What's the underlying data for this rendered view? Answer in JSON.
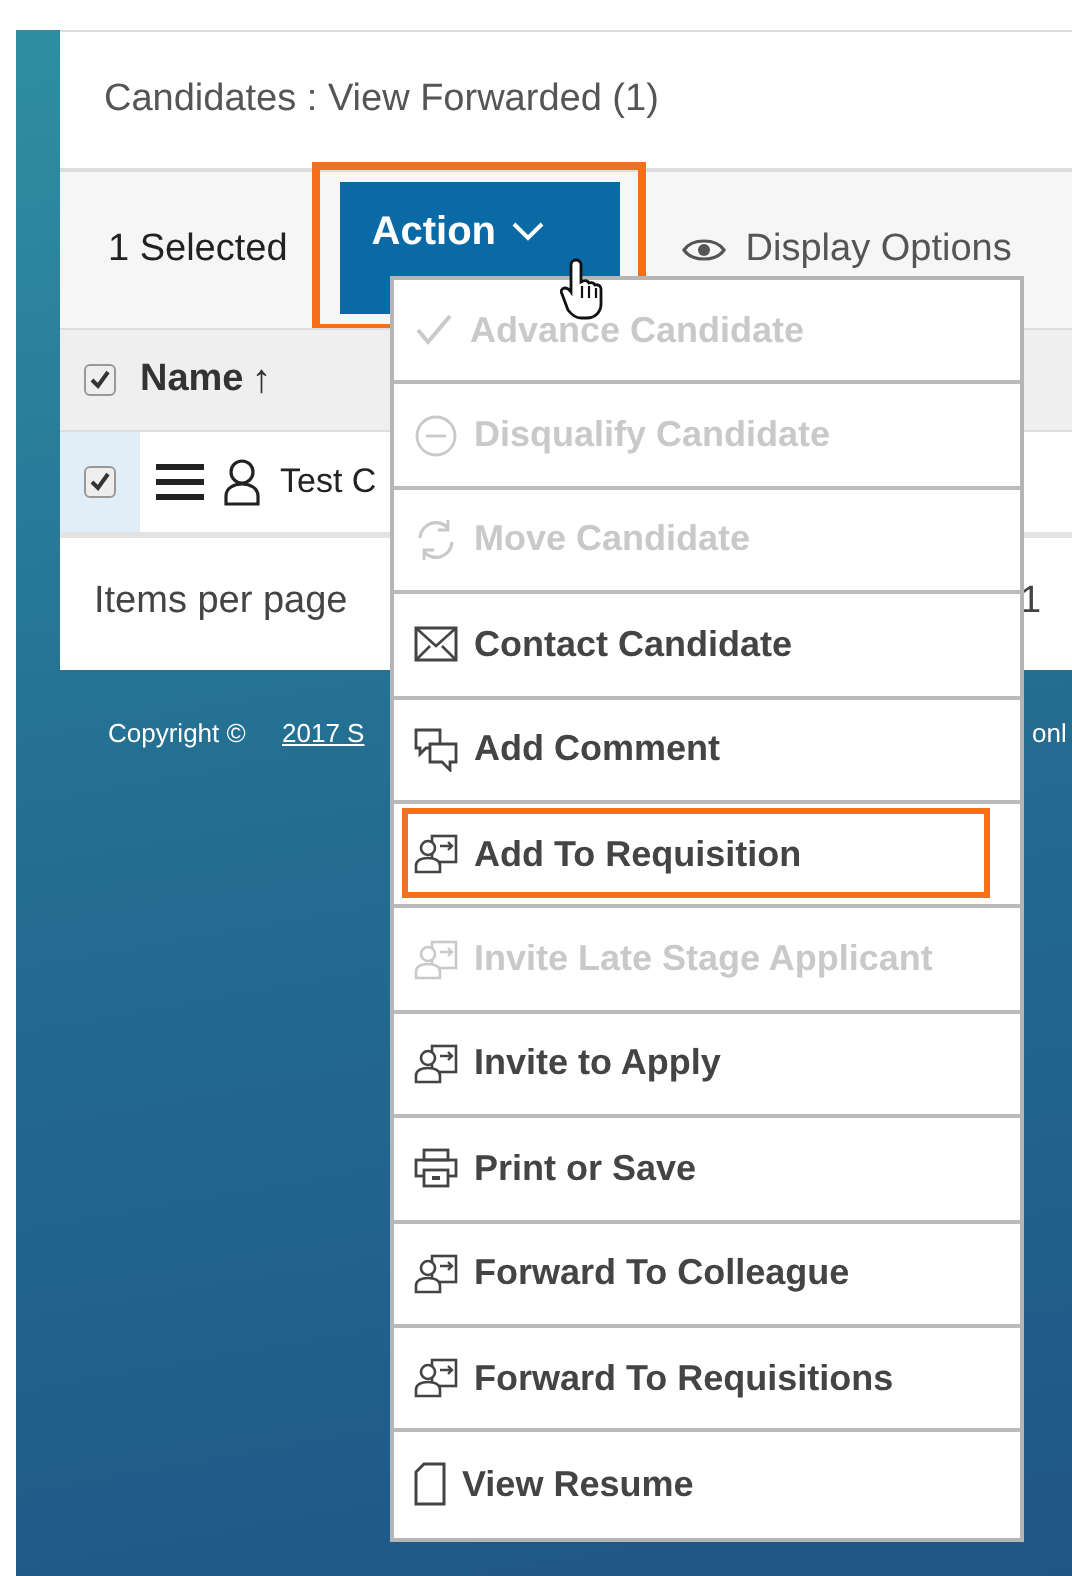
{
  "panel": {
    "title": "Candidates : View Forwarded (1)"
  },
  "toolbar": {
    "selected_count": "1 Selected",
    "action_button": {
      "label": "Action",
      "highlighted": true
    },
    "display_options": "Display Options"
  },
  "table": {
    "header": {
      "checked": true,
      "name_column": "Name",
      "sort_arrow": "↑"
    },
    "rows": [
      {
        "checked": true,
        "name": "Test C"
      }
    ]
  },
  "pagination": {
    "items_per_page": "Items per page",
    "page": "1"
  },
  "footer": {
    "copyright": "Copyright ©",
    "link": "2017 S",
    "trailing": "onl"
  },
  "menu": {
    "items": [
      {
        "label": "Advance Candidate",
        "kind": "check",
        "disabled": true,
        "highlighted": false
      },
      {
        "label": "Disqualify Candidate",
        "kind": "disqualify",
        "disabled": true,
        "highlighted": false
      },
      {
        "label": "Move Candidate",
        "kind": "move",
        "disabled": true,
        "highlighted": false
      },
      {
        "label": "Contact Candidate",
        "kind": "contact",
        "disabled": false,
        "highlighted": false
      },
      {
        "label": "Add Comment",
        "kind": "comment",
        "disabled": false,
        "highlighted": false
      },
      {
        "label": "Add To Requisition",
        "kind": "transfer",
        "disabled": false,
        "highlighted": true
      },
      {
        "label": "Invite Late Stage Applicant",
        "kind": "transfer",
        "disabled": true,
        "highlighted": false
      },
      {
        "label": "Invite to Apply",
        "kind": "transfer",
        "disabled": false,
        "highlighted": false
      },
      {
        "label": "Print or Save",
        "kind": "print",
        "disabled": false,
        "highlighted": false
      },
      {
        "label": "Forward To Colleague",
        "kind": "transfer",
        "disabled": false,
        "highlighted": false
      },
      {
        "label": "Forward To Requisitions",
        "kind": "transfer",
        "disabled": false,
        "highlighted": false
      },
      {
        "label": "View Resume",
        "kind": "resume",
        "disabled": false,
        "highlighted": false
      }
    ]
  }
}
